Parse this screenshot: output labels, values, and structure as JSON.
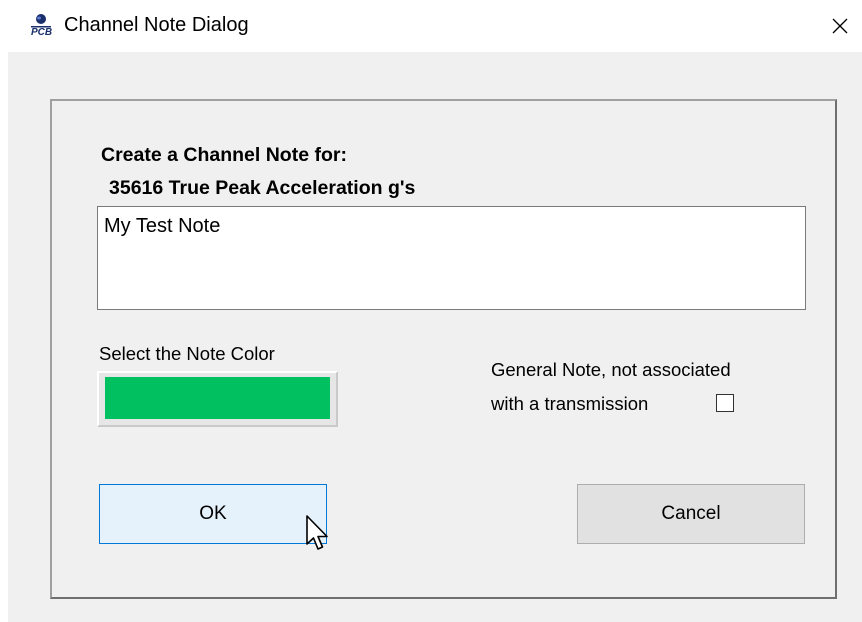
{
  "window": {
    "title": "Channel Note Dialog",
    "close_glyph": "×",
    "app_icon": "pcb-logo-icon"
  },
  "dialog": {
    "heading_line1": "Create a Channel Note for:",
    "heading_line2": "35616 True Peak Acceleration g's",
    "note_value": "My Test Note",
    "color_label": "Select the Note Color",
    "selected_color": "#00c060",
    "general_note_line1": "General Note, not associated",
    "general_note_line2": "with a transmission",
    "general_note_checked": false,
    "ok_label": "OK",
    "cancel_label": "Cancel"
  },
  "colors": {
    "dialog_bg": "#f0f0f0",
    "ok_button_bg": "#e5f1fb",
    "ok_button_border": "#0078d7",
    "cancel_button_bg": "#e1e1e1"
  }
}
